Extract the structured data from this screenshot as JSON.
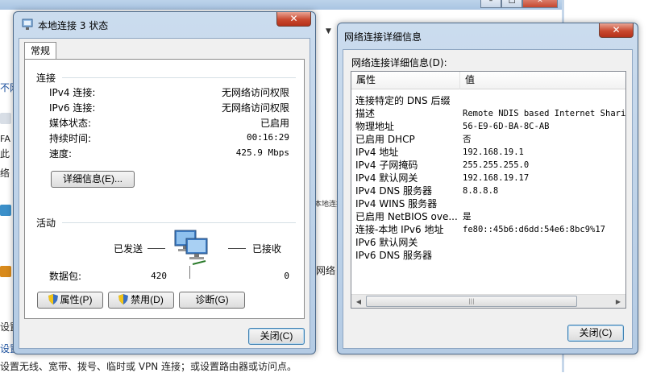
{
  "background": {
    "fragments": [
      "本地连接 3 状态 本地连接",
      "不网",
      "FA",
      "此",
      "络",
      "网络",
      "设置",
      "设置",
      "设置无线、宽带、拨号、临时或 VPN 连接；或设置路由器或访问点。"
    ]
  },
  "status_window": {
    "title": "本地连接 3 状态",
    "tab_label": "常规",
    "connection_group": "连接",
    "rows": [
      {
        "label": "IPv4 连接:",
        "value": "无网络访问权限"
      },
      {
        "label": "IPv6 连接:",
        "value": "无网络访问权限"
      },
      {
        "label": "媒体状态:",
        "value": "已启用"
      },
      {
        "label": "持续时间:",
        "value": "00:16:29"
      },
      {
        "label": "速度:",
        "value": "425.9 Mbps"
      }
    ],
    "details_button": "详细信息(E)...",
    "activity_group": "活动",
    "sent_label": "已发送",
    "received_label": "已接收",
    "packets_label": "数据包:",
    "packets_sent": "420",
    "packets_received": "0",
    "properties_button": "属性(P)",
    "disable_button": "禁用(D)",
    "diagnose_button": "诊断(G)",
    "close_button": "关闭(C)"
  },
  "details_window": {
    "title": "网络连接详细信息",
    "list_label": "网络连接详细信息(D):",
    "col_property": "属性",
    "col_value": "值",
    "rows": [
      {
        "name": "连接特定的 DNS 后缀",
        "value": ""
      },
      {
        "name": "描述",
        "value": "Remote NDIS based Internet Sharin"
      },
      {
        "name": "物理地址",
        "value": "56-E9-6D-BA-8C-AB"
      },
      {
        "name": "已启用 DHCP",
        "value": "否"
      },
      {
        "name": "IPv4 地址",
        "value": "192.168.19.1"
      },
      {
        "name": "IPv4 子网掩码",
        "value": "255.255.255.0"
      },
      {
        "name": "IPv4 默认网关",
        "value": "192.168.19.17"
      },
      {
        "name": "IPv4 DNS 服务器",
        "value": "8.8.8.8"
      },
      {
        "name": "IPv4 WINS 服务器",
        "value": ""
      },
      {
        "name": "已启用 NetBIOS ove...",
        "value": "是"
      },
      {
        "name": "连接-本地 IPv6 地址",
        "value": "fe80::45b6:d6dd:54e6:8bc9%17"
      },
      {
        "name": "IPv6 默认网关",
        "value": ""
      },
      {
        "name": "IPv6 DNS 服务器",
        "value": ""
      }
    ],
    "close_button": "关闭(C)"
  },
  "colors": {
    "accent": "#3c7fb1",
    "close_red": "#c9492f",
    "title_bar": "#b4cbe4"
  }
}
